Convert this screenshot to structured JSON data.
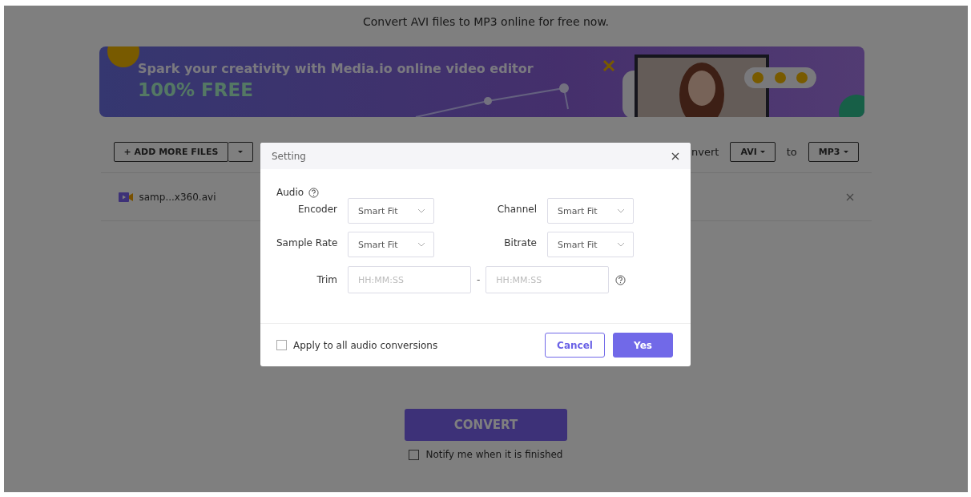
{
  "page_title": "Convert AVI files to MP3 online for free now.",
  "banner": {
    "headline": "Spark your creativity with Media.io online video editor",
    "tagline": "100% FREE"
  },
  "toolbar": {
    "add_button": "+ ADD MORE FILES",
    "convert_label": "nvert",
    "from_format": "AVI",
    "to_label": "to",
    "to_format": "MP3"
  },
  "files": [
    {
      "name": "samp...x360.avi"
    }
  ],
  "convert_button": "CONVERT",
  "notify": {
    "label": "Notify me when it is finished",
    "checked": false
  },
  "dialog": {
    "title": "Setting",
    "section": "Audio",
    "fields": [
      {
        "label": "Encoder",
        "value": "Smart Fit"
      },
      {
        "label": "Channel",
        "value": "Smart Fit"
      },
      {
        "label": "Sample Rate",
        "value": "Smart Fit"
      },
      {
        "label": "Bitrate",
        "value": "Smart Fit"
      }
    ],
    "trim": {
      "label": "Trim",
      "start_placeholder": "HH:MM:SS",
      "separator": "-",
      "end_placeholder": "HH:MM:SS"
    },
    "apply_all": {
      "label": "Apply to all audio conversions",
      "checked": false
    },
    "buttons": [
      {
        "label": "Cancel",
        "kind": "secondary"
      },
      {
        "label": "Yes",
        "kind": "primary"
      }
    ]
  }
}
